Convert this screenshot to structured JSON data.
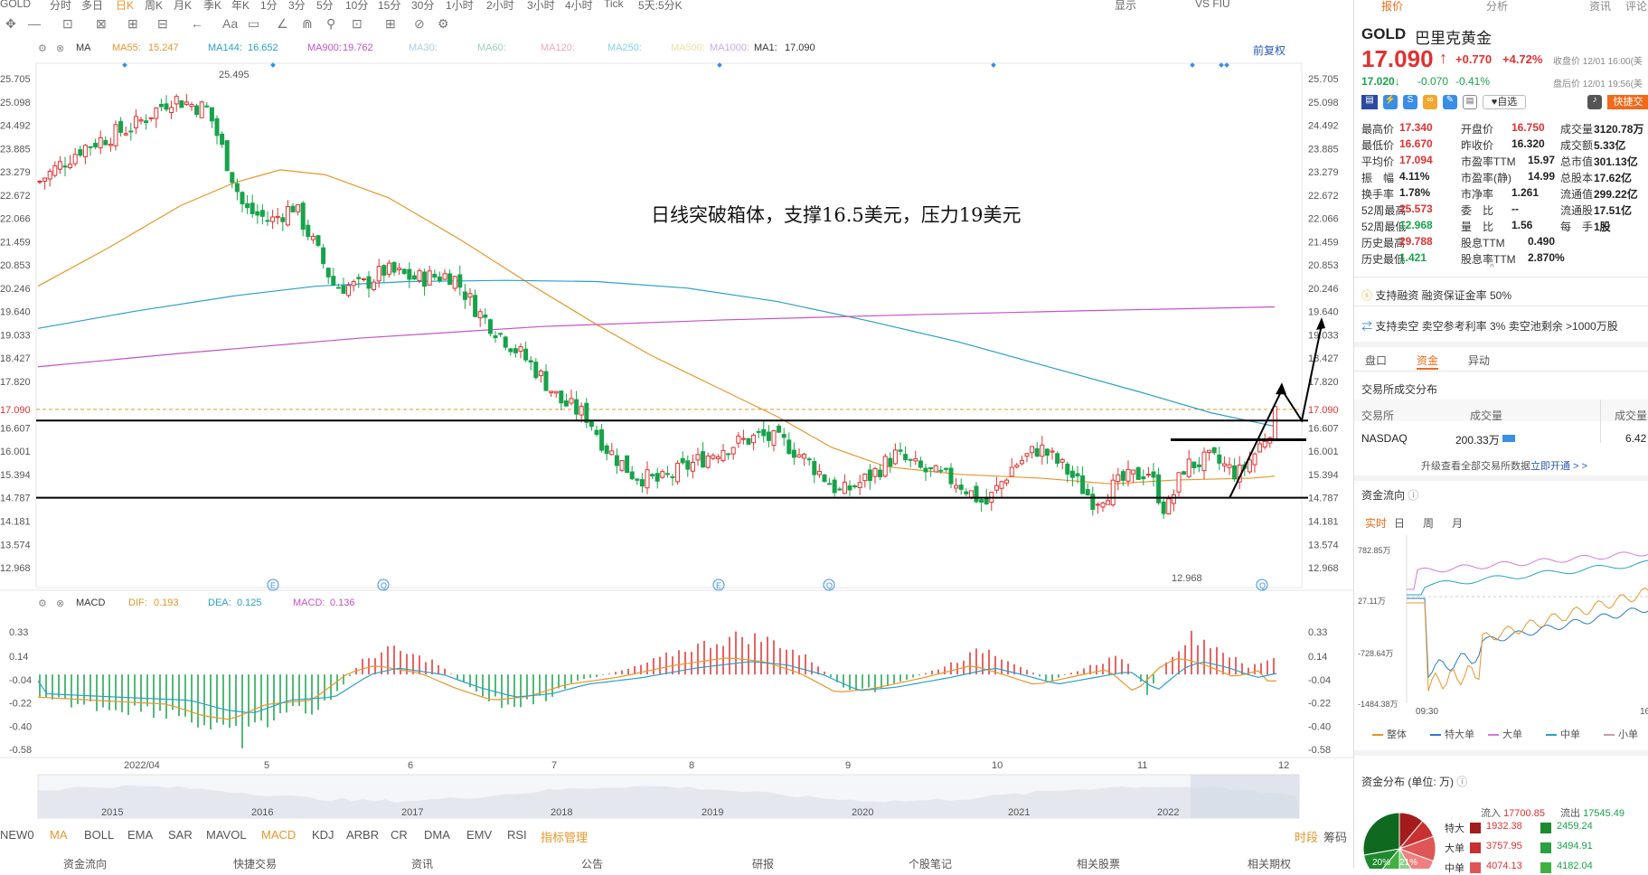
{
  "top_toolbar": {
    "items": [
      [
        "GOLD",
        0
      ],
      [
        "分时",
        55
      ],
      [
        "多日",
        90
      ],
      [
        "日K",
        128
      ],
      [
        "周K",
        160
      ],
      [
        "月K",
        192
      ],
      [
        "季K",
        225
      ],
      [
        "年K",
        256
      ],
      [
        "1分",
        288
      ],
      [
        "3分",
        319
      ],
      [
        "5分",
        350
      ],
      [
        "10分",
        382
      ],
      [
        "15分",
        418
      ],
      [
        "30分",
        455
      ],
      [
        "1小时",
        493
      ],
      [
        "2小时",
        538
      ],
      [
        "3小时",
        583
      ],
      [
        "4小时",
        625
      ],
      [
        "Tick",
        668
      ],
      [
        "5天:5分K",
        706
      ]
    ],
    "right": [
      [
        "显示",
        1233
      ],
      [
        "VS FIU",
        1322
      ]
    ]
  },
  "draw_toolbar": [
    "✥",
    "—",
    "⊡",
    "⊠",
    "⊞",
    "⊟",
    "←",
    "Aa",
    "▭",
    "∠",
    "⋒",
    "⚲",
    "⊡",
    "⊞",
    "⊘",
    "⚙"
  ],
  "ma_bar": {
    "items": [
      [
        "MA",
        0,
        "#333"
      ],
      [
        "MA55:",
        0,
        "#e8962b"
      ],
      [
        "15.247",
        0,
        "#e8962b"
      ],
      [
        "MA144:",
        0,
        "#2aa0c8"
      ],
      [
        "16.652",
        0,
        "#2aa0c8"
      ],
      [
        "MA900:",
        0,
        "#c453c4"
      ],
      [
        "19.762",
        0,
        "#c453c4"
      ],
      [
        "MA30:",
        0,
        "#a8cde6"
      ],
      [
        "MA60:",
        0,
        "#9ad0b8"
      ],
      [
        "MA120:",
        0,
        "#f0a9b9"
      ],
      [
        "MA250:",
        0,
        "#7fd4f0"
      ],
      [
        "MA500:",
        0,
        "#f0e0a0"
      ],
      [
        "MA1000:",
        0,
        "#c9a9e6"
      ],
      [
        "MA1:",
        0,
        "#333"
      ],
      [
        "17.090",
        0,
        "#333"
      ]
    ],
    "fuquan": "前复权"
  },
  "macd_bar": {
    "name": "MACD",
    "dif_label": "DIF:",
    "dif": "0.193",
    "dea_label": "DEA:",
    "dea": "0.125",
    "macd_label": "MACD:",
    "macd": "0.136"
  },
  "annotation": "日线突破箱体，支撑16.5美元，压力19美元",
  "price_labels": {
    "high": "25.495",
    "low": "12.968"
  },
  "chart_data": {
    "type": "candlestick",
    "title": "",
    "yticks": [
      "25.705",
      "25.098",
      "24.492",
      "23.885",
      "23.279",
      "22.672",
      "22.066",
      "21.459",
      "20.853",
      "20.246",
      "19.640",
      "19.033",
      "18.427",
      "17.820",
      "17.090",
      "16.607",
      "16.001",
      "15.394",
      "14.787",
      "14.181",
      "13.574",
      "12.968"
    ],
    "ytick_values": [
      25.705,
      25.098,
      24.492,
      23.885,
      23.279,
      22.672,
      22.066,
      21.459,
      20.853,
      20.246,
      19.64,
      19.033,
      18.427,
      17.82,
      17.09,
      16.607,
      16.001,
      15.394,
      14.787,
      14.181,
      13.574,
      12.968
    ],
    "xticks": [
      "2022/04",
      "5",
      "6",
      "7",
      "8",
      "9",
      "10",
      "11",
      "12"
    ],
    "macd_yticks": [
      "0.33",
      "0.14",
      "-0.04",
      "-0.22",
      "-0.40",
      "-0.58"
    ],
    "timeline_years": [
      "2015",
      "2016",
      "2017",
      "2018",
      "2019",
      "2020",
      "2021",
      "2022"
    ],
    "current_price": 17.09,
    "horizontal_lines": [
      16.8,
      14.79
    ],
    "series": [
      {
        "name": "MA55"
      },
      {
        "name": "MA144"
      },
      {
        "name": "MA900"
      }
    ]
  },
  "indicator_tabs": [
    "NEW0",
    "MA",
    "BOLL",
    "EMA",
    "SAR",
    "MAVOL",
    "MACD",
    "KDJ",
    "ARBR",
    "CR",
    "DMA",
    "EMV",
    "RSI",
    "指标管理"
  ],
  "indicator_right": [
    "时段",
    "筹码"
  ],
  "bottom_nav": [
    "资金流向",
    "快捷交易",
    "资讯",
    "公告",
    "研报",
    "个股笔记",
    "相关股票",
    "相关期权"
  ],
  "rp": {
    "tabs": [
      "报价",
      "分析",
      "资讯",
      "评论"
    ],
    "code": "GOLD",
    "name": "巴里克黄金",
    "price": "17.090",
    "arrow": "↑",
    "change": "+0.770",
    "pct": "+4.72%",
    "close_info": "收盘价 12/01 16:00(美",
    "after_price": "17.020↓",
    "after_change": "-0.070",
    "after_pct": "-0.41%",
    "after_info": "盘后价 12/01 19:56(美",
    "zixuan": "自选",
    "kuaijie": "快捷交",
    "quotes": [
      [
        [
          "最高价",
          "17.340",
          "red"
        ],
        [
          "开盘价",
          "16.750",
          "red"
        ],
        [
          "成交量",
          "3120.78万",
          ""
        ]
      ],
      [
        [
          "最低价",
          "16.670",
          "red"
        ],
        [
          "昨收价",
          "16.320",
          ""
        ],
        [
          "成交额",
          "5.33亿",
          ""
        ]
      ],
      [
        [
          "平均价",
          "17.094",
          "red"
        ],
        [
          "市盈率TTM",
          "15.97",
          ""
        ],
        [
          "总市值",
          "301.13亿",
          ""
        ]
      ],
      [
        [
          "振　幅",
          "4.11%",
          ""
        ],
        [
          "市盈率(静)",
          "14.99",
          ""
        ],
        [
          "总股本",
          "17.62亿",
          ""
        ]
      ],
      [
        [
          "换手率",
          "1.78%",
          ""
        ],
        [
          "市净率",
          "1.261",
          ""
        ],
        [
          "流通值",
          "299.22亿",
          ""
        ]
      ],
      [
        [
          "52周最高",
          "25.573",
          "red"
        ],
        [
          "委　比",
          "--",
          ""
        ],
        [
          "流通股",
          "17.51亿",
          ""
        ]
      ],
      [
        [
          "52周最低",
          "12.968",
          "green"
        ],
        [
          "量　比",
          "1.56",
          ""
        ],
        [
          "每　手",
          "1股",
          ""
        ]
      ],
      [
        [
          "历史最高",
          "29.788",
          "red"
        ],
        [
          "股息TTM",
          "0.490",
          ""
        ]
      ],
      [
        [
          "历史最低",
          "1.421",
          "green"
        ],
        [
          "股息率TTM",
          "2.870%",
          ""
        ]
      ]
    ],
    "margin": "支持融资  融资保证金率 50%",
    "short": "支持卖空  卖空参考利率 3%  卖空池剩余 >1000万股",
    "subtabs": [
      "盘口",
      "资金",
      "异动"
    ],
    "dist_title": "交易所成交分布",
    "dist_head": [
      "交易所",
      "成交量",
      "成交量"
    ],
    "dist_row": [
      "NASDAQ",
      "200.33万",
      "6.42"
    ],
    "upgrade": "升级查看全部交易所数据",
    "upgrade_link": "立即开通 > >",
    "flow_title": "资金流向",
    "flow_tabs": [
      "实时",
      "日",
      "周",
      "月"
    ],
    "flow_y": [
      "782.85万",
      "27.11万",
      "-728.64万",
      "-1484.38万"
    ],
    "flow_x": [
      "09:30",
      "16"
    ],
    "flow_legend": [
      [
        "整体",
        "#e8962b"
      ],
      [
        "特大单",
        "#2a7bc8"
      ],
      [
        "大单",
        "#d77ad7"
      ],
      [
        "中单",
        "#2aa0c8"
      ],
      [
        "小单",
        "#c9a"
      ]
    ],
    "dist2_title": "资金分布 (单位: 万)",
    "inflow_label": "流入",
    "inflow": "17700.85",
    "outflow_label": "流出",
    "outflow": "17545.49",
    "dist_rows": [
      [
        "特大",
        "1932.38",
        "2459.24"
      ],
      [
        "大单",
        "3757.95",
        "3494.91"
      ],
      [
        "中单",
        "4074.13",
        "4182.04"
      ]
    ],
    "pie_labels": [
      "20%",
      "21%"
    ]
  }
}
